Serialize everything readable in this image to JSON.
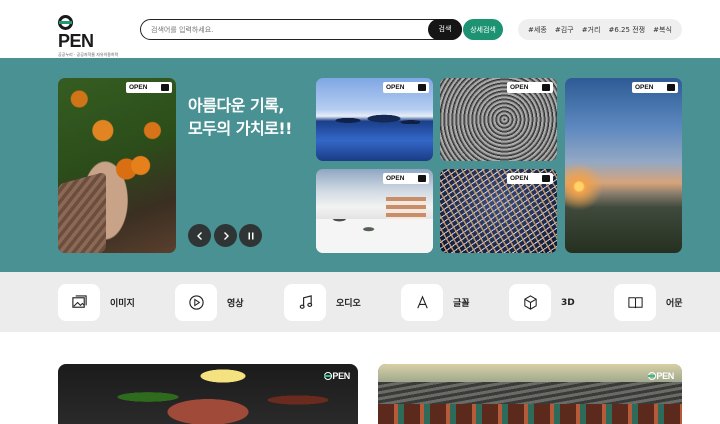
{
  "header": {
    "logo_text": "PEN",
    "logo_subtitle": "공공누리 · 공공저작물 자유이용허락",
    "search": {
      "placeholder": "검색어를 입력하세요.",
      "button_label": "검색"
    },
    "advanced_search_label": "상세검색",
    "tags": [
      "#세종",
      "#김구",
      "#거리",
      "#6.25 전쟁",
      "#복식"
    ]
  },
  "hero": {
    "title_line1": "아름다운 기록,",
    "title_line2": "모두의 가치로!!",
    "photo_badge": "OPEN",
    "controls": {
      "prev_icon": "chevron-left-icon",
      "next_icon": "chevron-right-icon",
      "pause_icon": "pause-icon"
    },
    "background_color": "#4a9194"
  },
  "categories": [
    {
      "label": "이미지",
      "icon": "image-icon"
    },
    {
      "label": "영상",
      "icon": "play-icon"
    },
    {
      "label": "오디오",
      "icon": "music-note-icon"
    },
    {
      "label": "글꼴",
      "icon": "font-icon"
    },
    {
      "label": "3D",
      "icon": "cube-icon"
    },
    {
      "label": "어문",
      "icon": "book-icon"
    }
  ],
  "cards": {
    "logo_text": "PEN"
  },
  "colors": {
    "accent": "#1d9373",
    "dark": "#151515",
    "category_bg": "#ececec"
  }
}
